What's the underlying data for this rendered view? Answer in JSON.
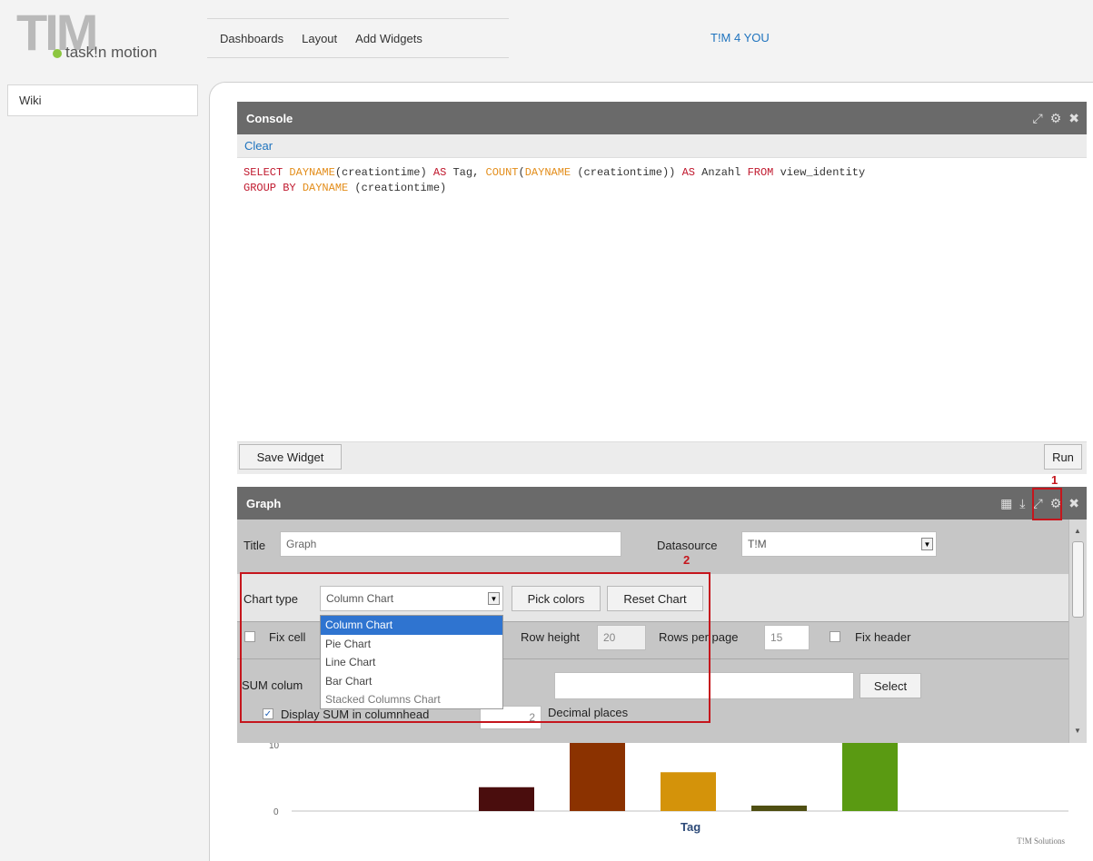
{
  "header": {
    "logo_text": "TIM",
    "logo_sub": "task!n motion",
    "nav": [
      "Dashboards",
      "Layout",
      "Add Widgets"
    ],
    "right_link": "T!M 4 YOU"
  },
  "sidebar": {
    "items": [
      {
        "label": "Wiki"
      }
    ]
  },
  "console": {
    "title": "Console",
    "clear_label": "Clear",
    "query_line1": [
      "SELECT",
      "DAYNAME",
      "(creationtime) ",
      "AS",
      " Tag, ",
      "COUNT",
      "(",
      "DAYNAME",
      " (creationtime)) ",
      "AS",
      " Anzahl ",
      "FROM",
      " view_identity"
    ],
    "query_line2": [
      "GROUP BY",
      " ",
      "DAYNAME",
      " (creationtime)"
    ],
    "save_label": "Save Widget",
    "run_label": "Run"
  },
  "graph": {
    "title": "Graph",
    "title_label": "Title",
    "title_value": "Graph",
    "datasource_label": "Datasource",
    "datasource_value": "T!M",
    "chart_type_label": "Chart type",
    "chart_type_value": "Column Chart",
    "pick_colors": "Pick colors",
    "reset_chart": "Reset Chart",
    "fix_cells_label": "Fix cell",
    "row_height_label": "Row height",
    "row_height_value": "20",
    "rows_per_page_label": "Rows per page",
    "rows_per_page_value": "15",
    "fix_header_label": "Fix header",
    "sum_label": "SUM colum",
    "select_label": "Select",
    "display_sum_label": "Display SUM in columnhead",
    "decimal_value": "2",
    "decimal_label": "Decimal places",
    "chart_options": [
      "Column Chart",
      "Pie Chart",
      "Line Chart",
      "Bar Chart",
      "Stacked Columns Chart"
    ],
    "annotation_1": "1",
    "annotation_2": "2"
  },
  "chart_data": {
    "type": "bar",
    "xlabel": "Tag",
    "ylabel": "",
    "y_ticks": [
      "10",
      "0"
    ],
    "values": [
      3.5,
      10,
      5.7,
      0.8,
      10
    ],
    "colors": [
      "#4a0d0d",
      "#8b3200",
      "#d4930a",
      "#4f4f12",
      "#5a9a12"
    ],
    "credit": "T!M Solutions"
  }
}
